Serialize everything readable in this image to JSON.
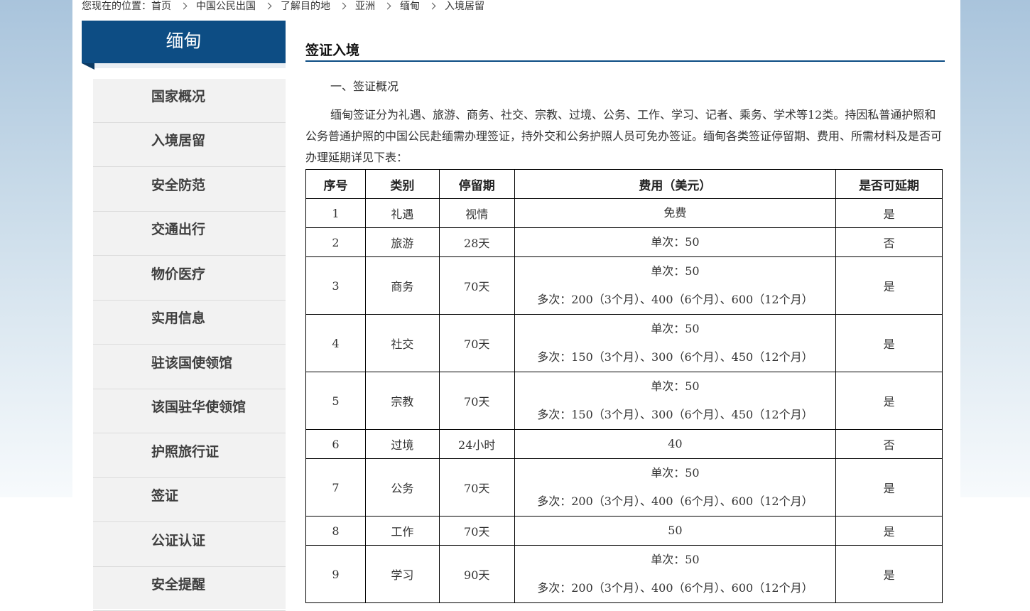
{
  "breadcrumb": {
    "prefix": "您现在的位置：",
    "items": [
      "首页",
      "中国公民出国",
      "了解目的地",
      "亚洲",
      "缅甸",
      "入境居留"
    ]
  },
  "sidebar": {
    "title": "缅甸",
    "items": [
      "国家概况",
      "入境居留",
      "安全防范",
      "交通出行",
      "物价医疗",
      "实用信息",
      "驻该国使领馆",
      "该国驻华使领馆",
      "护照旅行证",
      "签证",
      "公证认证",
      "安全提醒"
    ]
  },
  "main": {
    "section_title": "签证入境",
    "subheading": "一、签证概况",
    "intro": "缅甸签证分为礼遇、旅游、商务、社交、宗教、过境、公务、工作、学习、记者、乘务、学术等12类。持因私普通护照和公务普通护照的中国公民赴缅需办理签证，持外交和公务护照人员可免办签证。缅甸各类签证停留期、费用、所需材料及是否可办理延期详见下表：",
    "table": {
      "headers": [
        "序号",
        "类别",
        "停留期",
        "费用（美元）",
        "是否可延期"
      ],
      "rows": [
        {
          "no": "1",
          "type": "礼遇",
          "stay": "视情",
          "fee": [
            "免费"
          ],
          "ext": "是"
        },
        {
          "no": "2",
          "type": "旅游",
          "stay": "28天",
          "fee": [
            "单次：50"
          ],
          "ext": "否"
        },
        {
          "no": "3",
          "type": "商务",
          "stay": "70天",
          "fee": [
            "单次：50",
            "多次：200（3个月）、400（6个月）、600（12个月）"
          ],
          "ext": "是"
        },
        {
          "no": "4",
          "type": "社交",
          "stay": "70天",
          "fee": [
            "单次：50",
            "多次：150（3个月）、300（6个月）、450（12个月）"
          ],
          "ext": "是"
        },
        {
          "no": "5",
          "type": "宗教",
          "stay": "70天",
          "fee": [
            "单次：50",
            "多次：150（3个月）、300（6个月）、450（12个月）"
          ],
          "ext": "是"
        },
        {
          "no": "6",
          "type": "过境",
          "stay": "24小时",
          "fee": [
            "40"
          ],
          "ext": "否"
        },
        {
          "no": "7",
          "type": "公务",
          "stay": "70天",
          "fee": [
            "单次：50",
            "多次：200（3个月）、400（6个月）、600（12个月）"
          ],
          "ext": "是"
        },
        {
          "no": "8",
          "type": "工作",
          "stay": "70天",
          "fee": [
            "50"
          ],
          "ext": "是"
        },
        {
          "no": "9",
          "type": "学习",
          "stay": "90天",
          "fee": [
            "单次：50",
            "多次：200（3个月）、400（6个月）、600（12个月）"
          ],
          "ext": "是"
        }
      ]
    }
  }
}
